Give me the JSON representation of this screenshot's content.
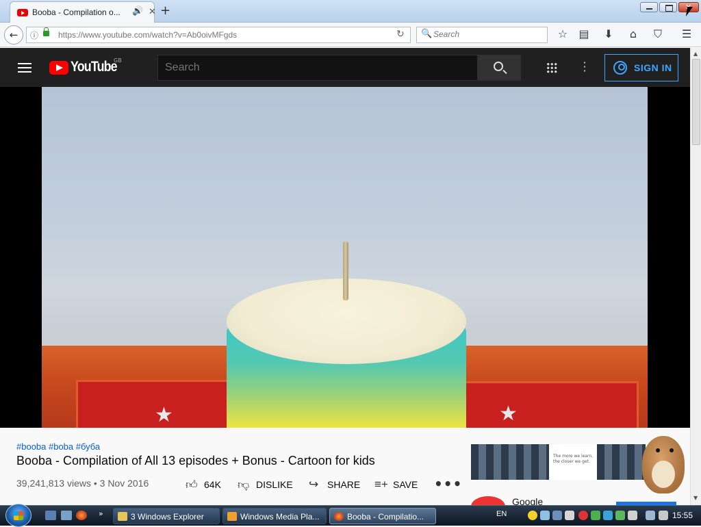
{
  "browser": {
    "tab": {
      "title": "Booba - Compilation o...",
      "audio_icon": "speaker-icon",
      "close_icon": "close-icon"
    },
    "new_tab_label": "+",
    "url": "https://www.youtube.com/watch?v=Ab0oivMFgds",
    "search_placeholder": "Search",
    "toolbar_icons": [
      "bookmark-star-icon",
      "reading-list-icon",
      "download-icon",
      "home-icon",
      "pocket-icon",
      "menu-icon"
    ]
  },
  "youtube": {
    "logo_text": "YouTube",
    "region": "GB",
    "search_placeholder": "Search",
    "signin_label": "SIGN IN",
    "accent_color": "#3ea6ff",
    "brand_color": "#ff0000"
  },
  "video": {
    "hashtags": "#booba #boba #буба",
    "title": "Booba - Compilation of All 13 episodes + Bonus - Cartoon for kids",
    "meta": "39,241,813 views • 3 Nov 2016",
    "actions": {
      "like": "64K",
      "dislike": "DISLIKE",
      "share": "SHARE",
      "save": "SAVE",
      "more": "•••"
    }
  },
  "ad": {
    "tagline": "The more we learn, the closer we get.",
    "advertiser": "Google"
  },
  "taskbar": {
    "tasks": [
      {
        "label": "3 Windows Explorer",
        "icon": "folder-icon"
      },
      {
        "label": "Windows Media Pla...",
        "icon": "media-player-icon"
      },
      {
        "label": "Booba - Compilatio...",
        "icon": "firefox-icon"
      }
    ],
    "language": "EN",
    "clock": "15:55"
  }
}
